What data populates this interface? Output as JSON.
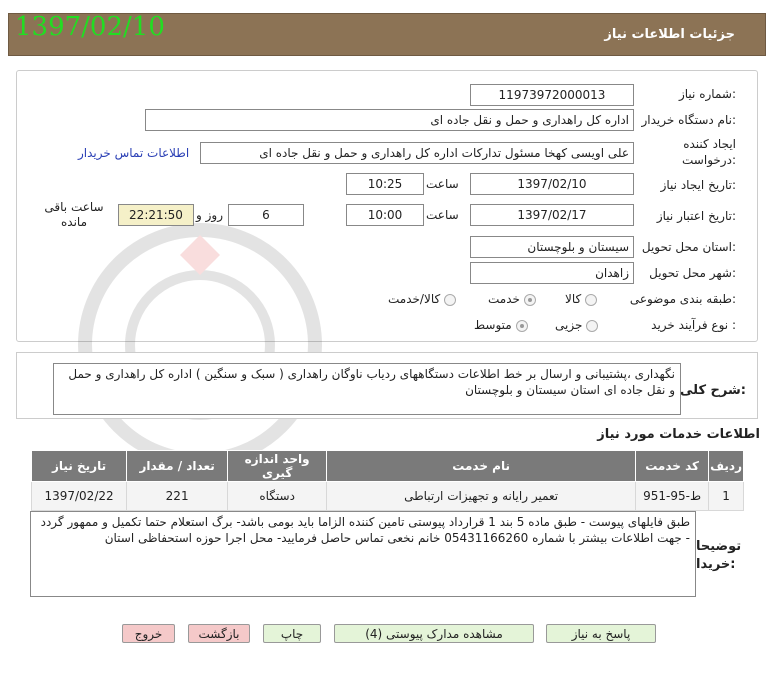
{
  "header": {
    "title": "جزئیات اطلاعات نیاز",
    "date": "1397/02/10"
  },
  "fields": {
    "need_number_label": "شماره نیاز:",
    "need_number": "11973972000013",
    "buyer_org_label": "نام دستگاه خریدار:",
    "buyer_org": "اداره کل راهداری و حمل و نقل جاده ای",
    "creator_label": "ایجاد کننده درخواست:",
    "creator": "علی اویسی کهخا مسئول تدارکات اداره کل راهداری و حمل و نقل جاده ای",
    "contact_link": "اطلاعات تماس خریدار",
    "created_date_label": "تاریخ ایجاد نیاز:",
    "created_date": "1397/02/10",
    "time_label": "ساعت",
    "created_time": "10:25",
    "deadline_label": "تاریخ اعتبار نیاز:",
    "deadline_date": "1397/02/17",
    "deadline_time": "10:00",
    "days": "6",
    "days_label": "روز و",
    "remaining": "22:21:50",
    "remaining_label": "ساعت باقی مانده",
    "province_label": "استان محل تحویل:",
    "province": "سیستان و بلوچستان",
    "city_label": "شهر محل تحویل:",
    "city": "زاهدان",
    "category_label": "طبقه بندی موضوعی:",
    "category_options": [
      "کالا",
      "خدمت",
      "کالا/خدمت"
    ],
    "process_label": "نوع فرآیند خرید :",
    "process_options": [
      "جزیی",
      "متوسط"
    ]
  },
  "summary": {
    "label": "شرح کلی نیاز:",
    "text": "نگهداری ،پشتیبانی و ارسال بر خط اطلاعات دستگاههای ردیاب ناوگان راهداری ( سبک و سنگین ) اداره کل راهداری و حمل و نقل جاده ای استان سیستان و بلوچستان"
  },
  "services": {
    "title": "اطلاعات خدمات مورد نیاز",
    "headers": [
      "ردیف",
      "کد خدمت",
      "نام خدمت",
      "واحد اندازه گیری",
      "تعداد / مقدار",
      "تاریخ نیاز"
    ],
    "rows": [
      [
        "1",
        "ط-95-951",
        "تعمیر رایانه و تجهیزات ارتباطی",
        "دستگاه",
        "221",
        "1397/02/22"
      ]
    ]
  },
  "notes": {
    "label": "توضیحات خریدار:",
    "text": "طبق فایلهای پیوست - طبق ماده 5 بند 1 قرارداد پیوستی تامین کننده الزاما باید بومی باشد- برگ استعلام حتما تکمیل و ممهور گردد - جهت اطلاعات بیشتر با شماره 05431166260 خانم نخعی تماس حاصل فرمایید- محل اجرا حوزه استحفاظی استان"
  },
  "buttons": {
    "reply": "پاسخ به نیاز",
    "attachments": "مشاهده مدارک پیوستی (4)",
    "print": "چاپ",
    "back": "بازگشت",
    "exit": "خروج"
  },
  "colors": {
    "header_bg": "#8c7355",
    "header_date": "#22dd22",
    "table_header": "#7a7a7a",
    "timer_bg": "#f5f0c8",
    "link": "#2a3fb5"
  }
}
